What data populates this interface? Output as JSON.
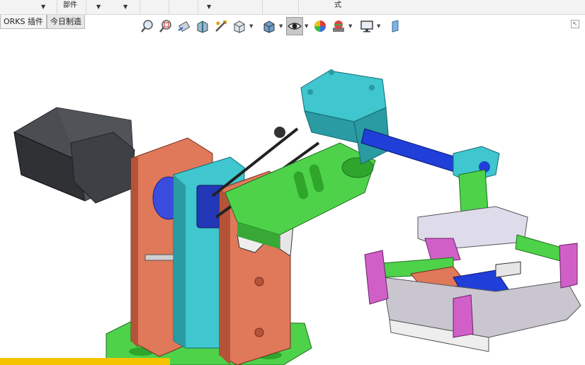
{
  "top": {
    "parts_label": "部件",
    "style_label": "式"
  },
  "tabs": [
    {
      "label": "ORKS 插件"
    },
    {
      "label": "今日制造"
    }
  ],
  "toolbar": {
    "tools": [
      {
        "icon": "zoom-to-fit-icon"
      },
      {
        "icon": "zoom-area-icon"
      },
      {
        "icon": "previous-view-icon"
      },
      {
        "icon": "section-view-icon"
      },
      {
        "icon": "dynamic-annotation-icon"
      },
      {
        "icon": "view-orientation-icon"
      },
      {
        "icon": "display-style-icon"
      },
      {
        "icon": "hide-show-items-icon"
      },
      {
        "icon": "edit-appearance-icon"
      },
      {
        "icon": "apply-scene-icon"
      },
      {
        "icon": "view-settings-icon"
      },
      {
        "icon": "orientation-box-icon"
      }
    ]
  },
  "colors": {
    "plate_orange": "#e0785a",
    "plate_cyan": "#3fc6cf",
    "arm_green": "#4ed24a",
    "shaft_blue": "#1f3fd8",
    "motor_gray": "#4a4d52",
    "gripper_magenta": "#d060c8",
    "base_gray": "#c9c6cf",
    "highlight_yellow": "#f5c300"
  }
}
